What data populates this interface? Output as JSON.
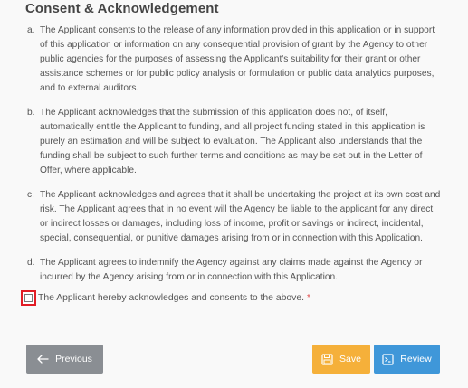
{
  "section": {
    "title": "Consent & Acknowledgement",
    "clauses": [
      {
        "letter": "a.",
        "text": "The Applicant consents to the release of any information provided in this application or in support of this application or information on any consequential provision of grant by the Agency to other public agencies for the purposes of assessing the Applicant's suitability for their grant or other assistance schemes or for public policy analysis or formulation or public data analytics purposes, and to external auditors."
      },
      {
        "letter": "b.",
        "text": "The Applicant acknowledges that the submission of this application does not, of itself, automatically entitle the Applicant to funding, and all project funding stated in this application is purely an estimation and will be subject to evaluation. The Applicant also understands that the funding shall be subject to such further terms and conditions as may be set out in the Letter of Offer, where applicable."
      },
      {
        "letter": "c.",
        "text": "The Applicant acknowledges and agrees that it shall be undertaking the project at its own cost and risk. The Applicant agrees that in no event will the Agency be liable to the applicant for any direct or indirect losses or damages, including loss of income, profit or savings or indirect, incidental, special, consequential, or punitive damages arising from or in connection with this Application."
      },
      {
        "letter": "d.",
        "text": "The Applicant agrees to indemnify the Agency against any claims made against the Agency or incurred by the Agency arising from or in connection with this Application."
      }
    ]
  },
  "acknowledgement": {
    "label": "The Applicant hereby acknowledges and consents to the above.",
    "required_mark": "*",
    "checked": false
  },
  "buttons": {
    "previous": {
      "label": "Previous",
      "icon": "arrow-left-icon"
    },
    "save": {
      "label": "Save",
      "icon": "floppy-disk-icon"
    },
    "review": {
      "label": "Review",
      "icon": "review-icon"
    }
  },
  "colors": {
    "previous": "#8a8e93",
    "save": "#f5b03a",
    "review": "#3f97d9",
    "highlight": "#e21d25",
    "required": "#e04a4a"
  }
}
